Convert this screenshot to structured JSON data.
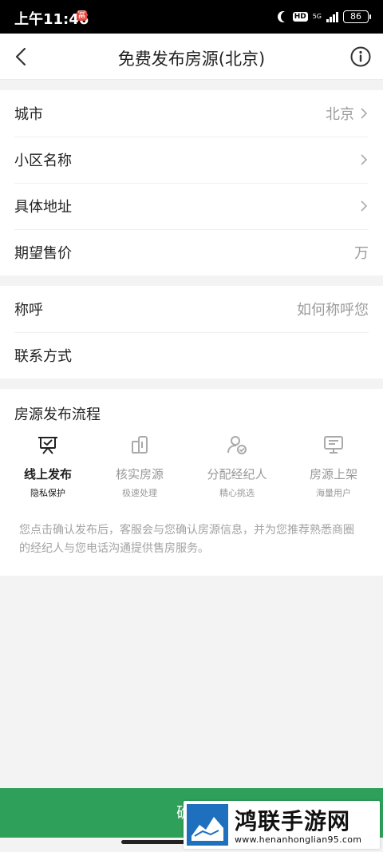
{
  "status_bar": {
    "time": "上午11:46",
    "app_badge": "冨",
    "hd": "HD",
    "network": "5G",
    "battery": "86"
  },
  "nav": {
    "title": "免费发布房源(北京)",
    "back_icon": "chevron-left-icon",
    "info_icon": "info-circle-icon"
  },
  "property_form": [
    {
      "label": "城市",
      "value": "北京",
      "chevron": true
    },
    {
      "label": "小区名称",
      "value": "",
      "chevron": true
    },
    {
      "label": "具体地址",
      "value": "",
      "chevron": true
    },
    {
      "label": "期望售价",
      "value": "万",
      "chevron": false
    }
  ],
  "contact_form": [
    {
      "label": "称呼",
      "placeholder": "如何称呼您"
    },
    {
      "label": "联系方式",
      "placeholder": ""
    }
  ],
  "process": {
    "title": "房源发布流程",
    "steps": [
      {
        "label": "线上发布",
        "sub": "隐私保护",
        "icon": "publish-board-icon",
        "active": true
      },
      {
        "label": "核实房源",
        "sub": "极速处理",
        "icon": "building-icon",
        "active": false
      },
      {
        "label": "分配经纪人",
        "sub": "精心挑选",
        "icon": "agent-check-icon",
        "active": false
      },
      {
        "label": "房源上架",
        "sub": "海量用户",
        "icon": "monitor-icon",
        "active": false
      }
    ],
    "note": "您点击确认发布后，客服会与您确认房源信息，并为您推荐熟悉商圈的经纪人与您电话沟通提供售房服务。"
  },
  "confirm_button": "确定",
  "watermark": {
    "title": "鸿联手游网",
    "url": "www.henanhonglian95.com"
  },
  "colors": {
    "accent_green": "#2ea05a",
    "text_primary": "#222222",
    "text_muted": "#999999",
    "background": "#f3f3f3"
  }
}
